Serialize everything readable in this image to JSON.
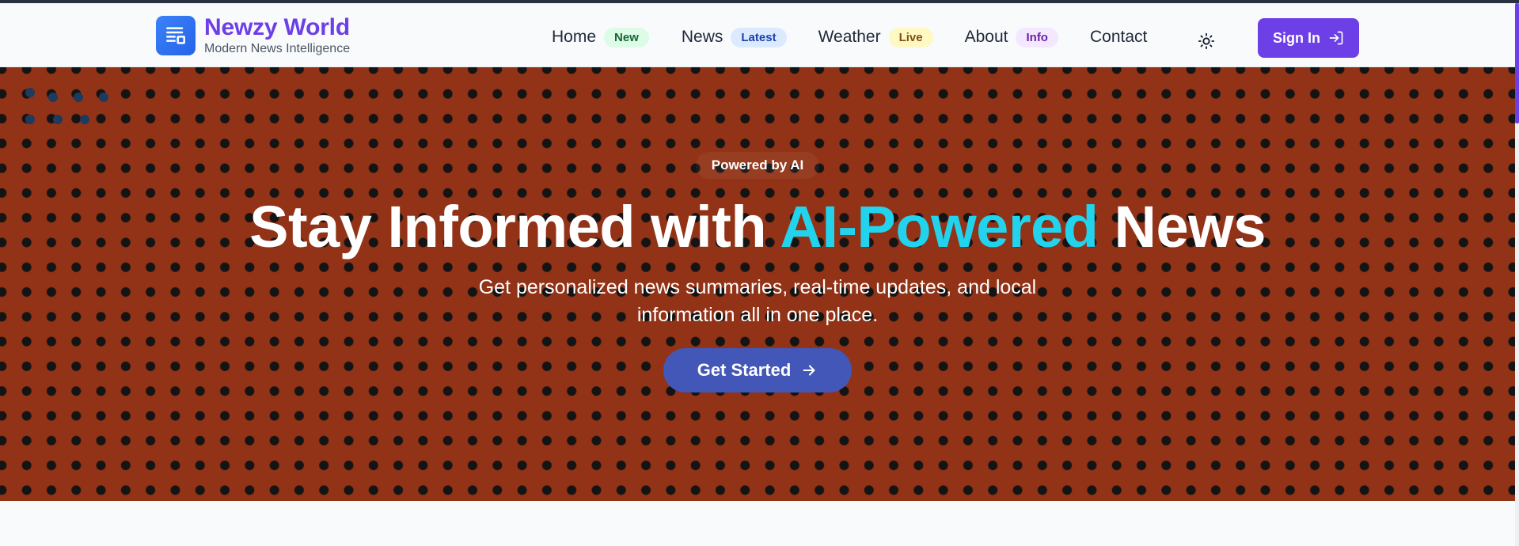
{
  "brand": {
    "title": "Newzy World",
    "subtitle": "Modern News Intelligence",
    "icon": "newspaper-icon"
  },
  "nav": {
    "items": [
      {
        "label": "Home",
        "badge": "New"
      },
      {
        "label": "News",
        "badge": "Latest"
      },
      {
        "label": "Weather",
        "badge": "Live"
      },
      {
        "label": "About",
        "badge": "Info"
      },
      {
        "label": "Contact",
        "badge": ""
      }
    ],
    "theme_toggle_icon": "sun-icon",
    "signin_label": "Sign In",
    "signin_icon": "sign-in-icon"
  },
  "hero": {
    "pill": "Powered by AI",
    "title_part1": "Stay Informed with ",
    "title_accent": "AI-Powered",
    "title_part2": " News",
    "description": "Get personalized news summaries, real-time updates, and local information all in one place.",
    "cta_label": "Get Started",
    "cta_icon": "arrow-right-icon"
  },
  "colors": {
    "brand": "#6d3fe6",
    "hero_bg": "#923317",
    "accent": "#22d3ee",
    "cta": "#4257b8"
  }
}
